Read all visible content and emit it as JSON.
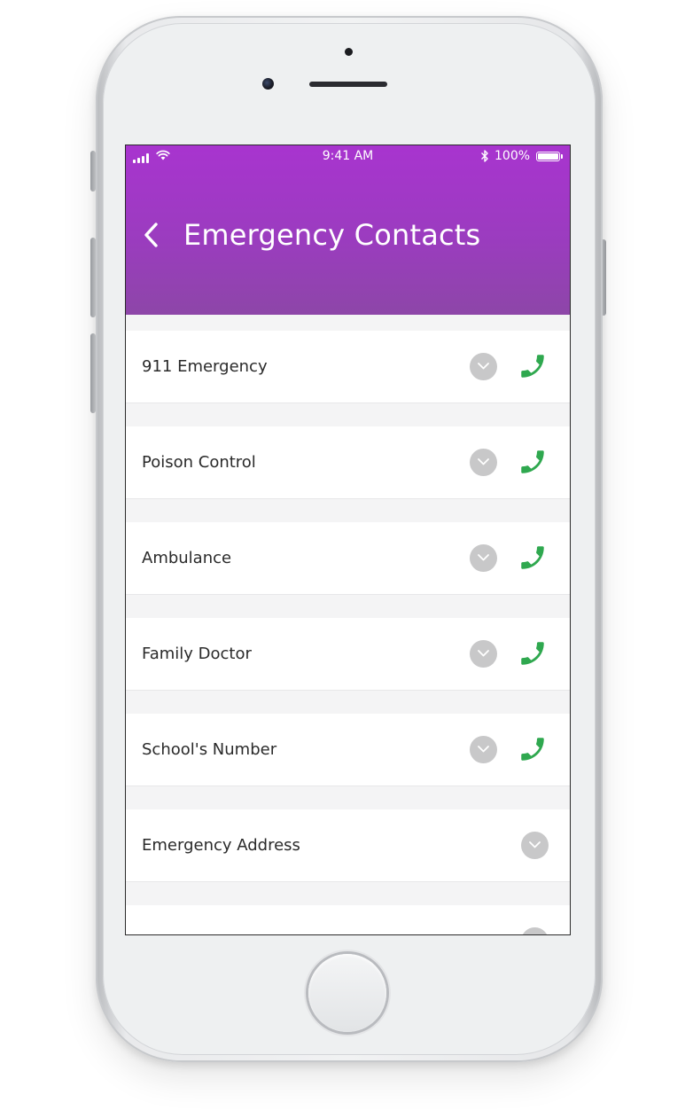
{
  "status_bar": {
    "time": "9:41 AM",
    "battery": "100%"
  },
  "header": {
    "title": "Emergency Contacts",
    "gradient_top": "#a834cf",
    "gradient_bottom": "#8d46a8"
  },
  "contacts": [
    {
      "label": "911 Emergency",
      "has_call": true
    },
    {
      "label": "Poison Control",
      "has_call": true
    },
    {
      "label": "Ambulance",
      "has_call": true
    },
    {
      "label": "Family Doctor",
      "has_call": true
    },
    {
      "label": "School's Number",
      "has_call": true
    },
    {
      "label": "Emergency Address",
      "has_call": false
    },
    {
      "label": "",
      "has_call": false
    }
  ],
  "icons": {
    "back": "chevron-left-icon",
    "expand": "chevron-down-icon",
    "call": "phone-icon"
  },
  "colors": {
    "call_green": "#2fa84f",
    "expand_gray": "#c8c8c9"
  }
}
